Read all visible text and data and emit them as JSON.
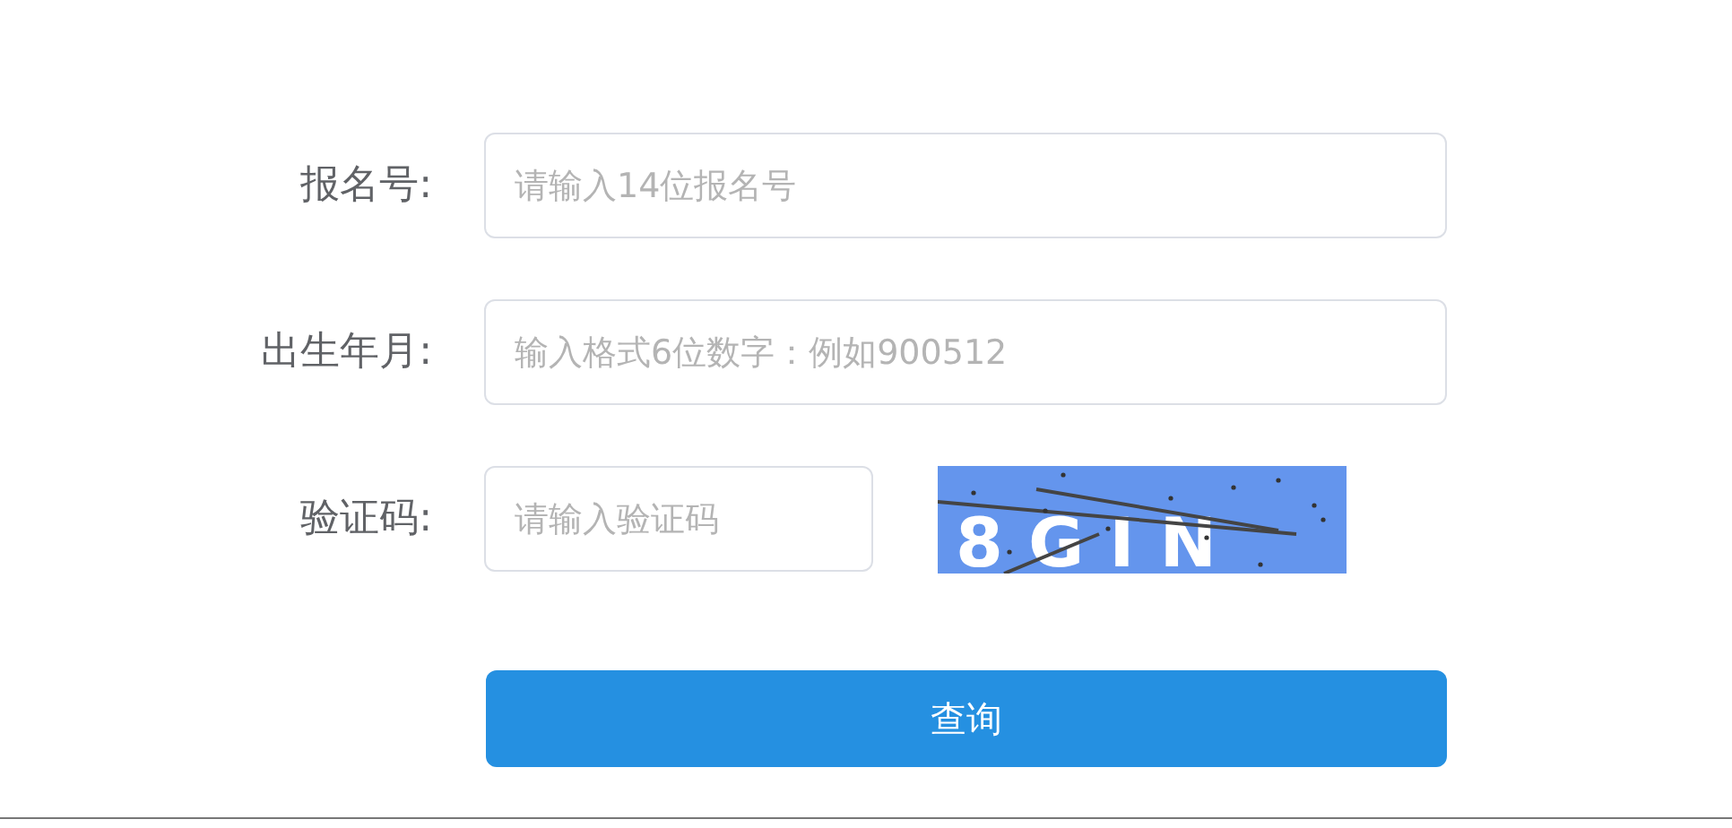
{
  "fields": [
    {
      "label": "报名号:",
      "placeholder": "请输入14位报名号",
      "kind": "text"
    },
    {
      "label": "出生年月:",
      "placeholder": "输入格式6位数字：例如900512",
      "kind": "text"
    },
    {
      "label": "验证码:",
      "placeholder": "请输入验证码",
      "kind": "captcha"
    }
  ],
  "captcha": {
    "text": "8GIN"
  },
  "submit": "查询"
}
